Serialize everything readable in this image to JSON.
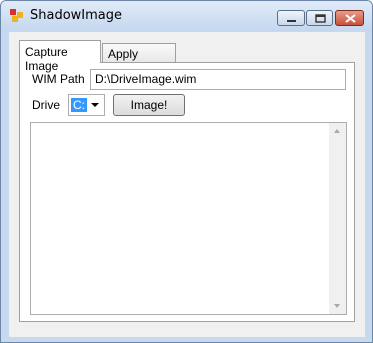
{
  "window": {
    "title": "ShadowImage",
    "icon": "app-icon",
    "controls": [
      "minimize-icon",
      "maximize-icon",
      "close-icon"
    ]
  },
  "tabs": [
    {
      "label": "Capture Image",
      "active": true
    },
    {
      "label": "Apply Image",
      "active": false
    }
  ],
  "form": {
    "wim_label": "WIM Path",
    "wim_value": "D:\\DriveImage.wim",
    "drive_label": "Drive",
    "drive_value": "C:",
    "image_button": "Image!",
    "output_text": ""
  },
  "colors": {
    "selection": "#3399ff",
    "close_button": "#c7503b"
  }
}
